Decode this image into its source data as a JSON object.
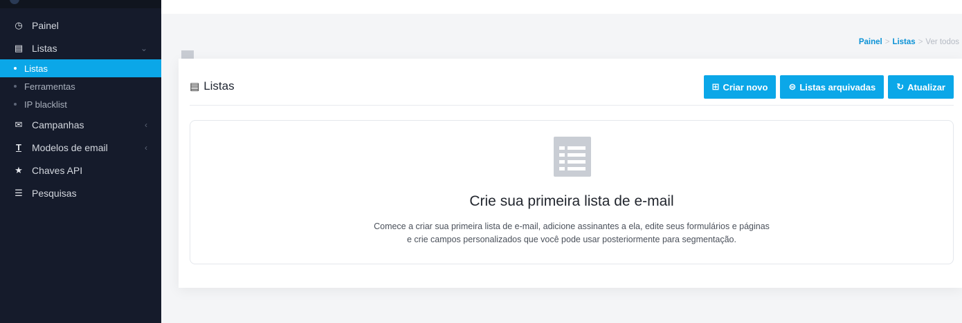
{
  "sidebar": {
    "items": [
      {
        "label": "Painel",
        "icon": "clock-icon"
      },
      {
        "label": "Listas",
        "icon": "list-icon"
      },
      {
        "label": "Listas",
        "sub": true,
        "active": true
      },
      {
        "label": "Ferramentas",
        "sub": true
      },
      {
        "label": "IP blacklist",
        "sub": true
      },
      {
        "label": "Campanhas",
        "icon": "envelope-icon"
      },
      {
        "label": "Modelos de email",
        "icon": "text-icon"
      },
      {
        "label": "Chaves API",
        "icon": "star-icon"
      },
      {
        "label": "Pesquisas",
        "icon": "list-ul-icon"
      }
    ]
  },
  "breadcrumb": {
    "home": "Painel",
    "section": "Listas",
    "current": "Ver todos"
  },
  "card": {
    "title": "Listas",
    "buttons": {
      "create": "Criar novo",
      "archived": "Listas arquivadas",
      "refresh": "Atualizar"
    }
  },
  "empty_state": {
    "title": "Crie sua primeira lista de e-mail",
    "description_line1": "Comece a criar sua primeira lista de e-mail, adicione assinantes a ela, edite seus formulários e páginas",
    "description_line2": "e crie campos personalizados que você pode usar posteriormente para segmentação."
  },
  "colors": {
    "sidebar_bg": "#151b2b",
    "accent": "#0ba7e8",
    "breadcrumb_link": "#0b92d6"
  }
}
